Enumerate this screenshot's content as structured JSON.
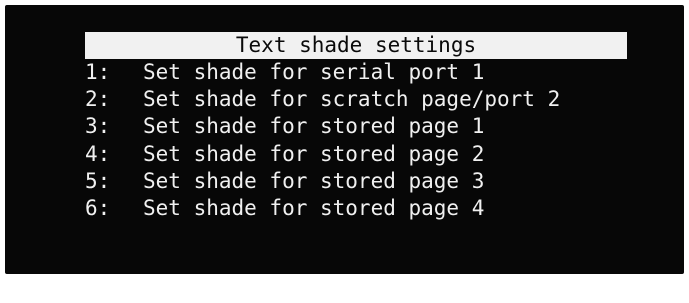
{
  "menu": {
    "title": "Text shade settings",
    "items": [
      {
        "key": "1:",
        "label": "Set shade for serial port 1"
      },
      {
        "key": "2:",
        "label": "Set shade for scratch page/port 2"
      },
      {
        "key": "3:",
        "label": "Set shade for stored page 1"
      },
      {
        "key": "4:",
        "label": "Set shade for stored page 2"
      },
      {
        "key": "5:",
        "label": "Set shade for stored page 3"
      },
      {
        "key": "6:",
        "label": "Set shade for stored page 4"
      }
    ]
  },
  "colors": {
    "screen_background": "#070707",
    "title_bar_background": "#f1f1f1",
    "title_text": "#0a0a0a",
    "item_text": "#f0f0f0"
  }
}
